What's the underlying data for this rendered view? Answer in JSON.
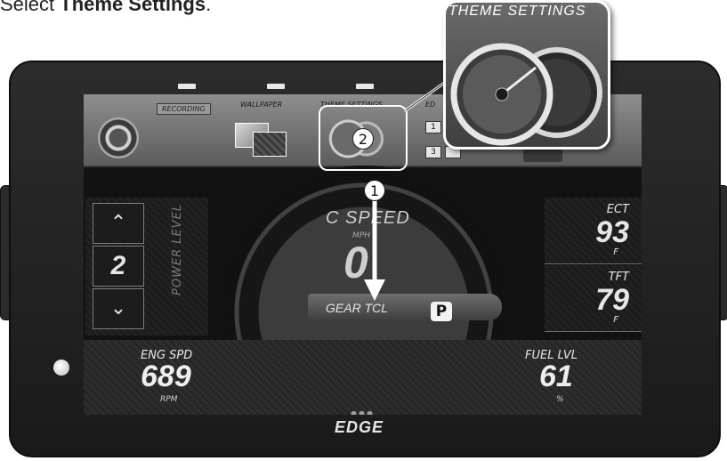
{
  "instruction": {
    "prefix": "Select ",
    "target": "Theme Settings",
    "suffix": "."
  },
  "top_menu": {
    "recording_label": "RECORDING",
    "items": [
      "WALLPAPER",
      "THEME SETTINGS",
      "ED"
    ],
    "layout_cells": [
      "1",
      "3"
    ],
    "help_label": "?"
  },
  "callout": {
    "title": "THEME SETTINGS"
  },
  "steps": {
    "one": "1",
    "two": "2"
  },
  "left_panel": {
    "up_icon": "chevron-up-icon",
    "value": "2",
    "down_icon": "chevron-down-icon",
    "label": "POWER LEVEL"
  },
  "gauge": {
    "title": "C SPEED",
    "unit": "MPH",
    "value": "0",
    "gear_label": "GEAR TCL",
    "gear_value": "P"
  },
  "right_panel": [
    {
      "label": "ECT",
      "value": "93",
      "unit": "F"
    },
    {
      "label": "TFT",
      "value": "79",
      "unit": "F"
    }
  ],
  "bottom_left": {
    "label": "ENG SPD",
    "value": "689",
    "unit": "RPM"
  },
  "bottom_right": {
    "label": "FUEL LVL",
    "value": "61",
    "unit": "%"
  },
  "brand": "EDGE",
  "colors": {
    "bezel": "#1f1f1f",
    "screen": "#121212",
    "highlight": "#ffffff"
  }
}
